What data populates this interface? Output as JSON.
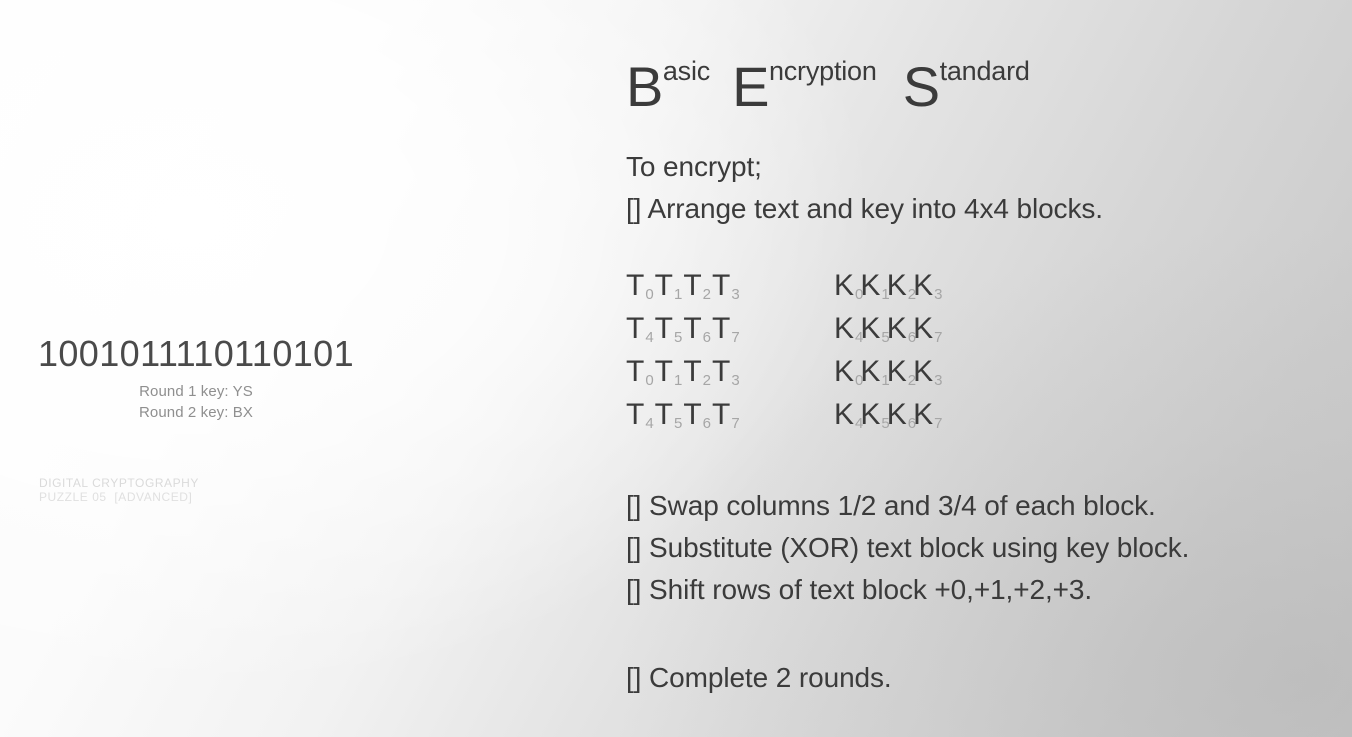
{
  "page": {
    "background_light": "#fdfdfd",
    "background_dark": "#c8c8c8",
    "text_color": "#3b3b3b",
    "muted_color": "#8f8f8f",
    "faint_color": "#dadada",
    "subscript_color": "#a6a6a6"
  },
  "title": {
    "words": [
      {
        "cap": "B",
        "rest": "asic"
      },
      {
        "cap": "E",
        "rest": "ncryption"
      },
      {
        "cap": "S",
        "rest": "tandard"
      }
    ],
    "full": "Basic Encryption Standard"
  },
  "left": {
    "cipher_text": "1001011110110101",
    "keys": [
      "Round 1 key: YS",
      "Round 2 key: BX"
    ],
    "footer": {
      "line1": "DIGITAL CRYPTOGRAPHY",
      "line2": "PUZZLE 05  [ADVANCED]"
    }
  },
  "instructions": {
    "intro": "To encrypt;",
    "arrange": "[] Arrange text and key into 4x4 blocks.",
    "swap": "[] Swap columns 1/2 and 3/4 of each block.",
    "xor": "[] Substitute (XOR) text block using key block.",
    "shift": "[] Shift rows of text block +0,+1,+2,+3.",
    "rounds": "[] Complete 2 rounds."
  },
  "blocks": {
    "text_block": {
      "symbol": "T",
      "rows": [
        [
          "0",
          "1",
          "2",
          "3"
        ],
        [
          "4",
          "5",
          "6",
          "7"
        ],
        [
          "0",
          "1",
          "2",
          "3"
        ],
        [
          "4",
          "5",
          "6",
          "7"
        ]
      ]
    },
    "key_block": {
      "symbol": "K",
      "rows": [
        [
          "0",
          "1",
          "2",
          "3"
        ],
        [
          "4",
          "5",
          "6",
          "7"
        ],
        [
          "0",
          "1",
          "2",
          "3"
        ],
        [
          "4",
          "5",
          "6",
          "7"
        ]
      ]
    }
  }
}
